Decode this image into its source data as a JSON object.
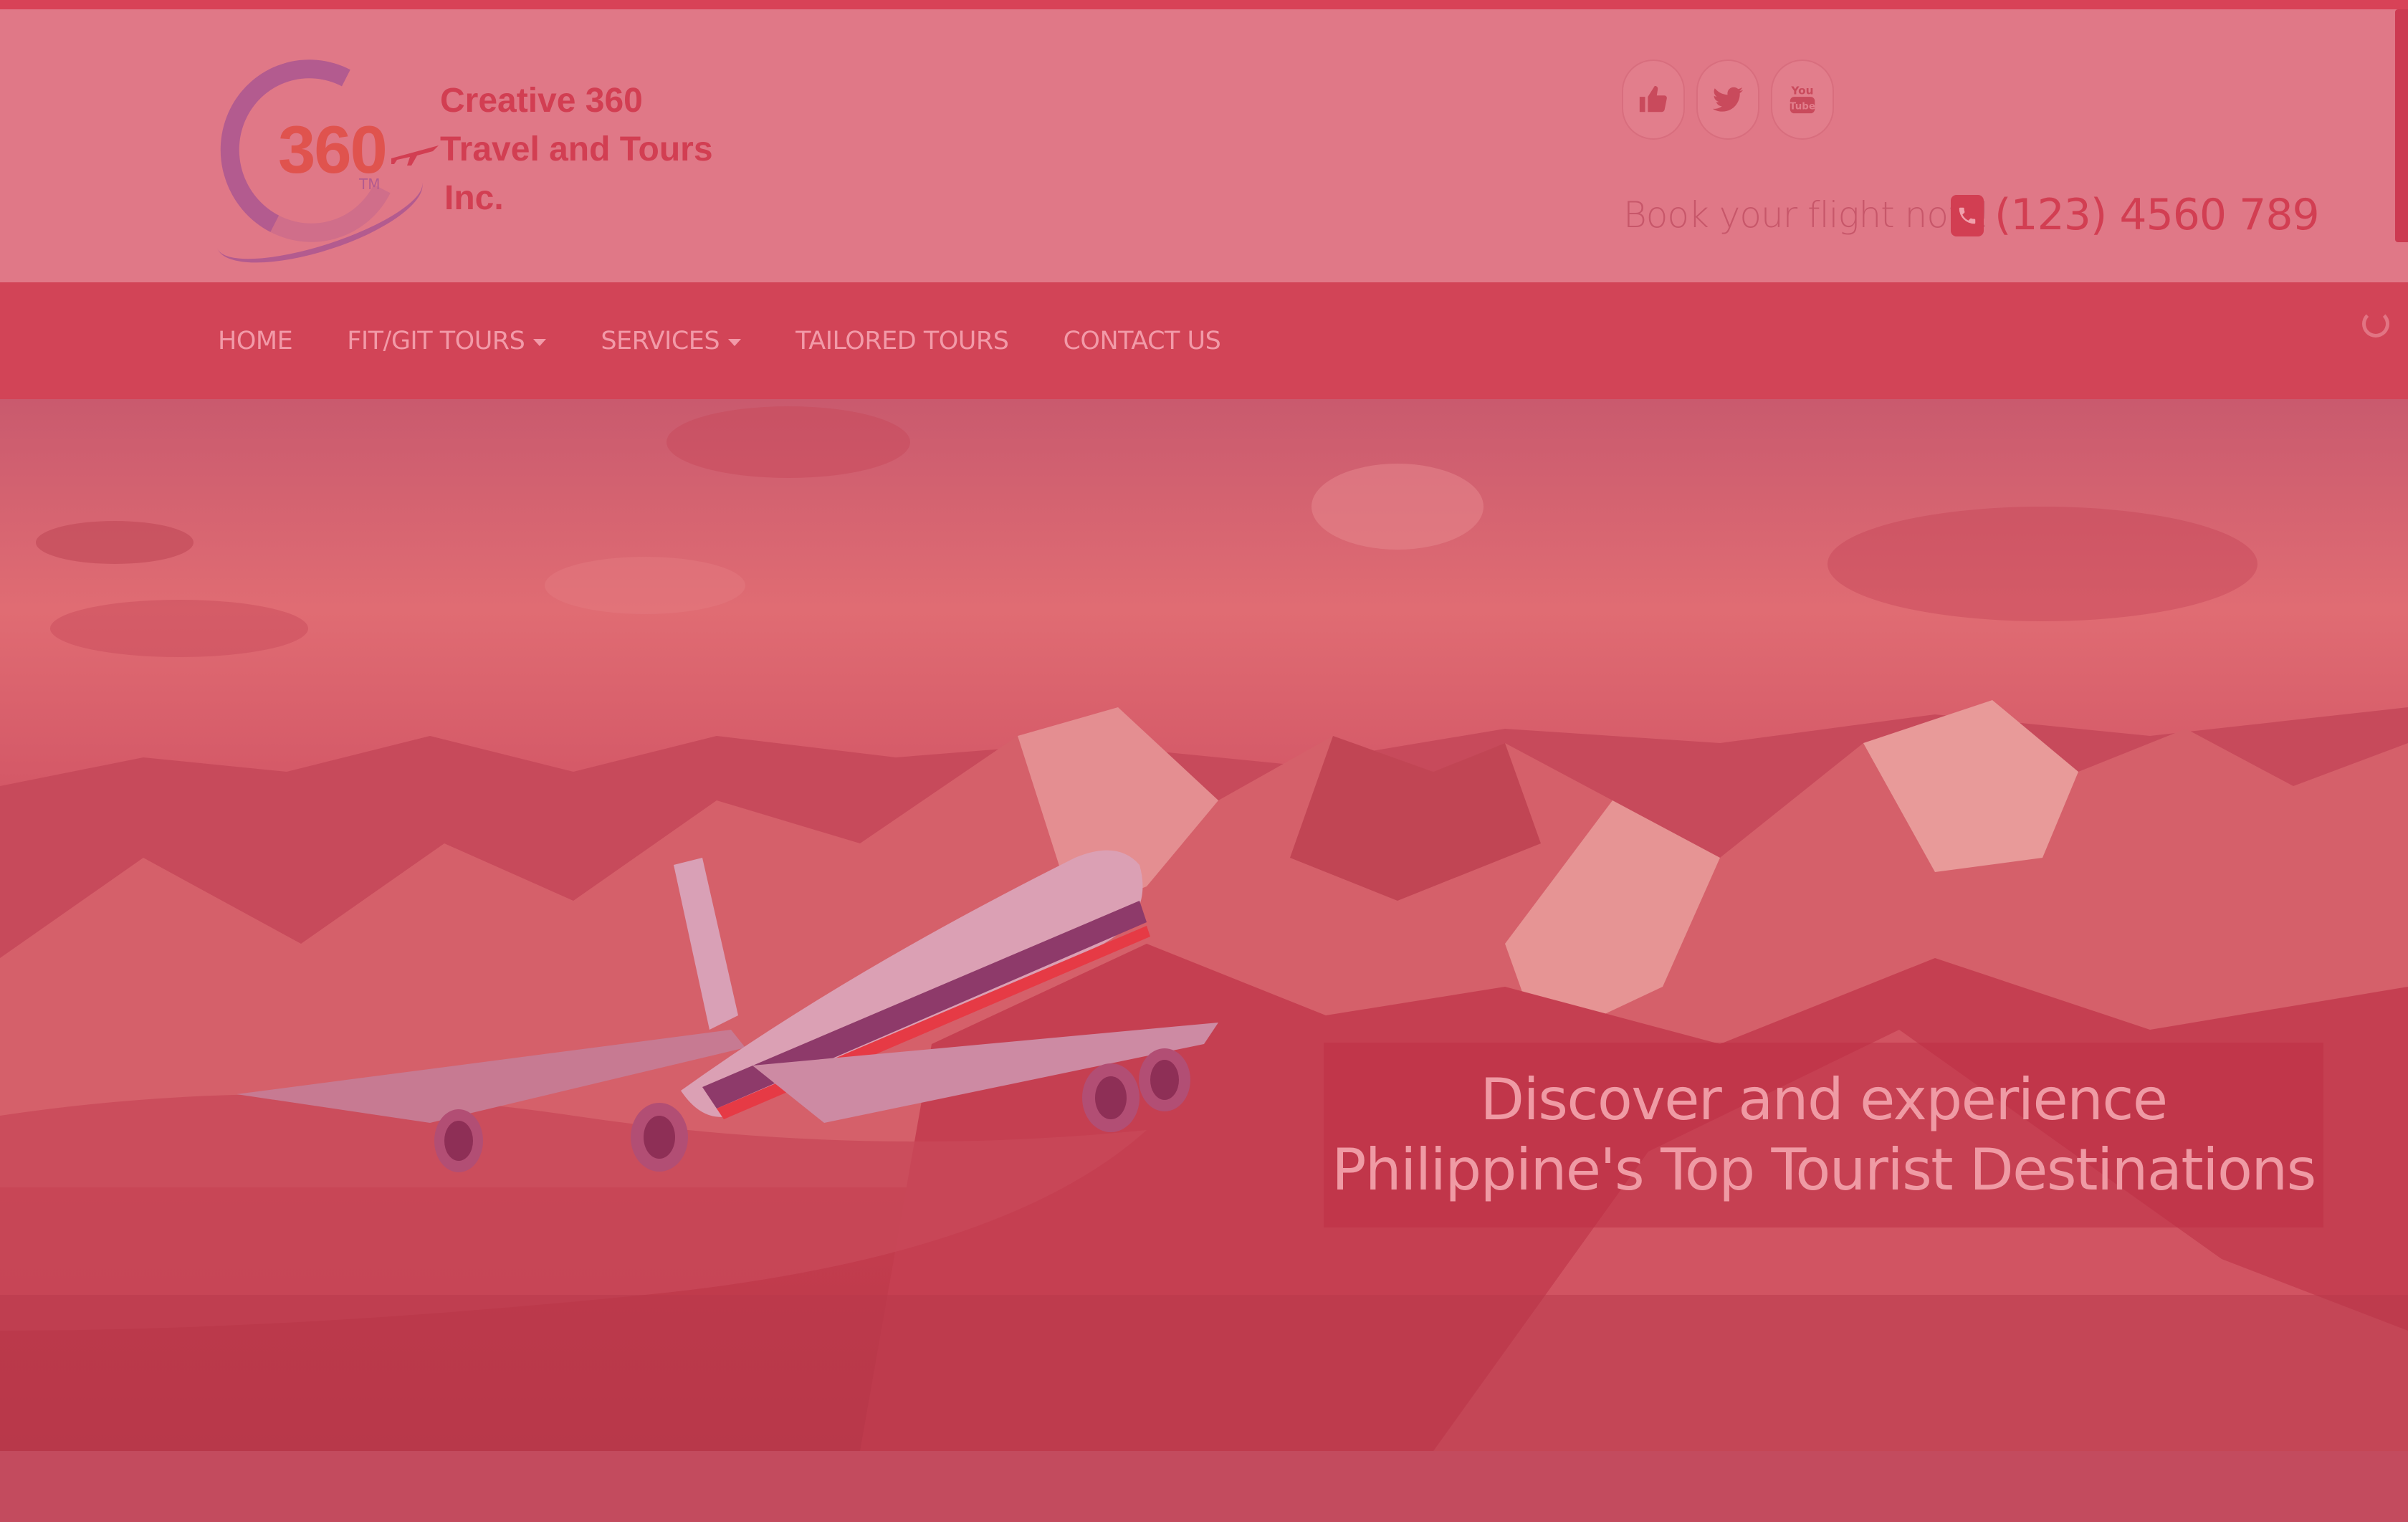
{
  "brand": {
    "logo_numeral": "360",
    "logo_tm": "TM",
    "name_lines": [
      "Creative 360",
      "Travel and Tours",
      "Inc."
    ]
  },
  "social": [
    {
      "name": "facebook-like",
      "icon": "thumbs-up-icon"
    },
    {
      "name": "twitter",
      "icon": "twitter-icon"
    },
    {
      "name": "youtube",
      "icon": "youtube-icon"
    }
  ],
  "contact": {
    "prompt": "Book your flight now!",
    "phone": "(123) 4560 789",
    "icon": "phone-icon"
  },
  "nav": {
    "items": [
      {
        "label": "HOME",
        "has_dropdown": false
      },
      {
        "label": "FIT/GIT TOURS",
        "has_dropdown": true
      },
      {
        "label": "SERVICES",
        "has_dropdown": true
      },
      {
        "label": "TAILORED TOURS",
        "has_dropdown": false
      },
      {
        "label": "CONTACT US",
        "has_dropdown": false
      }
    ]
  },
  "hero": {
    "caption": "Discover and experience Philippine's Top Tourist Destinations"
  },
  "colors": {
    "overlay": "#d84257",
    "header_bg": "#e07887",
    "nav_bg": "#d24457",
    "accent": "#d23e52"
  }
}
